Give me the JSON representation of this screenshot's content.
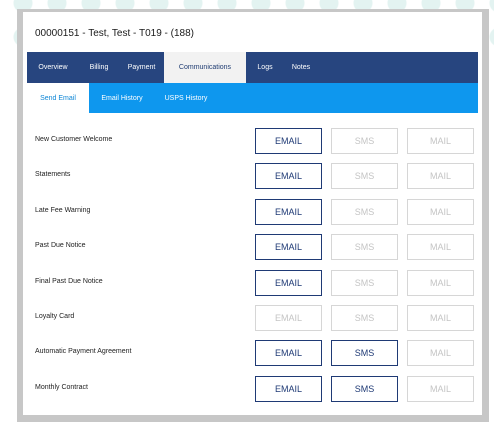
{
  "header": {
    "title": "00000151 - Test, Test - T019 - (188)"
  },
  "main_tabs": [
    {
      "label": "Overview"
    },
    {
      "label": "Billing"
    },
    {
      "label": "Payment"
    },
    {
      "label": "Communications"
    },
    {
      "label": "Logs"
    },
    {
      "label": "Notes"
    }
  ],
  "sub_tabs": [
    {
      "label": "Send Email"
    },
    {
      "label": "Email History"
    },
    {
      "label": "USPS History"
    }
  ],
  "communications": [
    {
      "label": "New Customer Welcome",
      "email": "EMAIL",
      "sms": "SMS",
      "mail": "MAIL"
    },
    {
      "label": "Statements",
      "email": "EMAIL",
      "sms": "SMS",
      "mail": "MAIL"
    },
    {
      "label": "Late Fee Warning",
      "email": "EMAIL",
      "sms": "SMS",
      "mail": "MAIL"
    },
    {
      "label": "Past Due Notice",
      "email": "EMAIL",
      "sms": "SMS",
      "mail": "MAIL"
    },
    {
      "label": "Final Past Due Notice",
      "email": "EMAIL",
      "sms": "SMS",
      "mail": "MAIL"
    },
    {
      "label": "Loyalty Card",
      "email": "EMAIL",
      "sms": "SMS",
      "mail": "MAIL"
    },
    {
      "label": "Automatic Payment Agreement",
      "email": "EMAIL",
      "sms": "SMS",
      "mail": "MAIL"
    },
    {
      "label": "Monthly Contract",
      "email": "EMAIL",
      "sms": "SMS",
      "mail": "MAIL"
    }
  ],
  "colors": {
    "nav_bar": "#27457f",
    "sub_nav_bar": "#0e97ee",
    "button_enabled": "#1f3a75",
    "button_disabled": "#c4c4c4"
  }
}
